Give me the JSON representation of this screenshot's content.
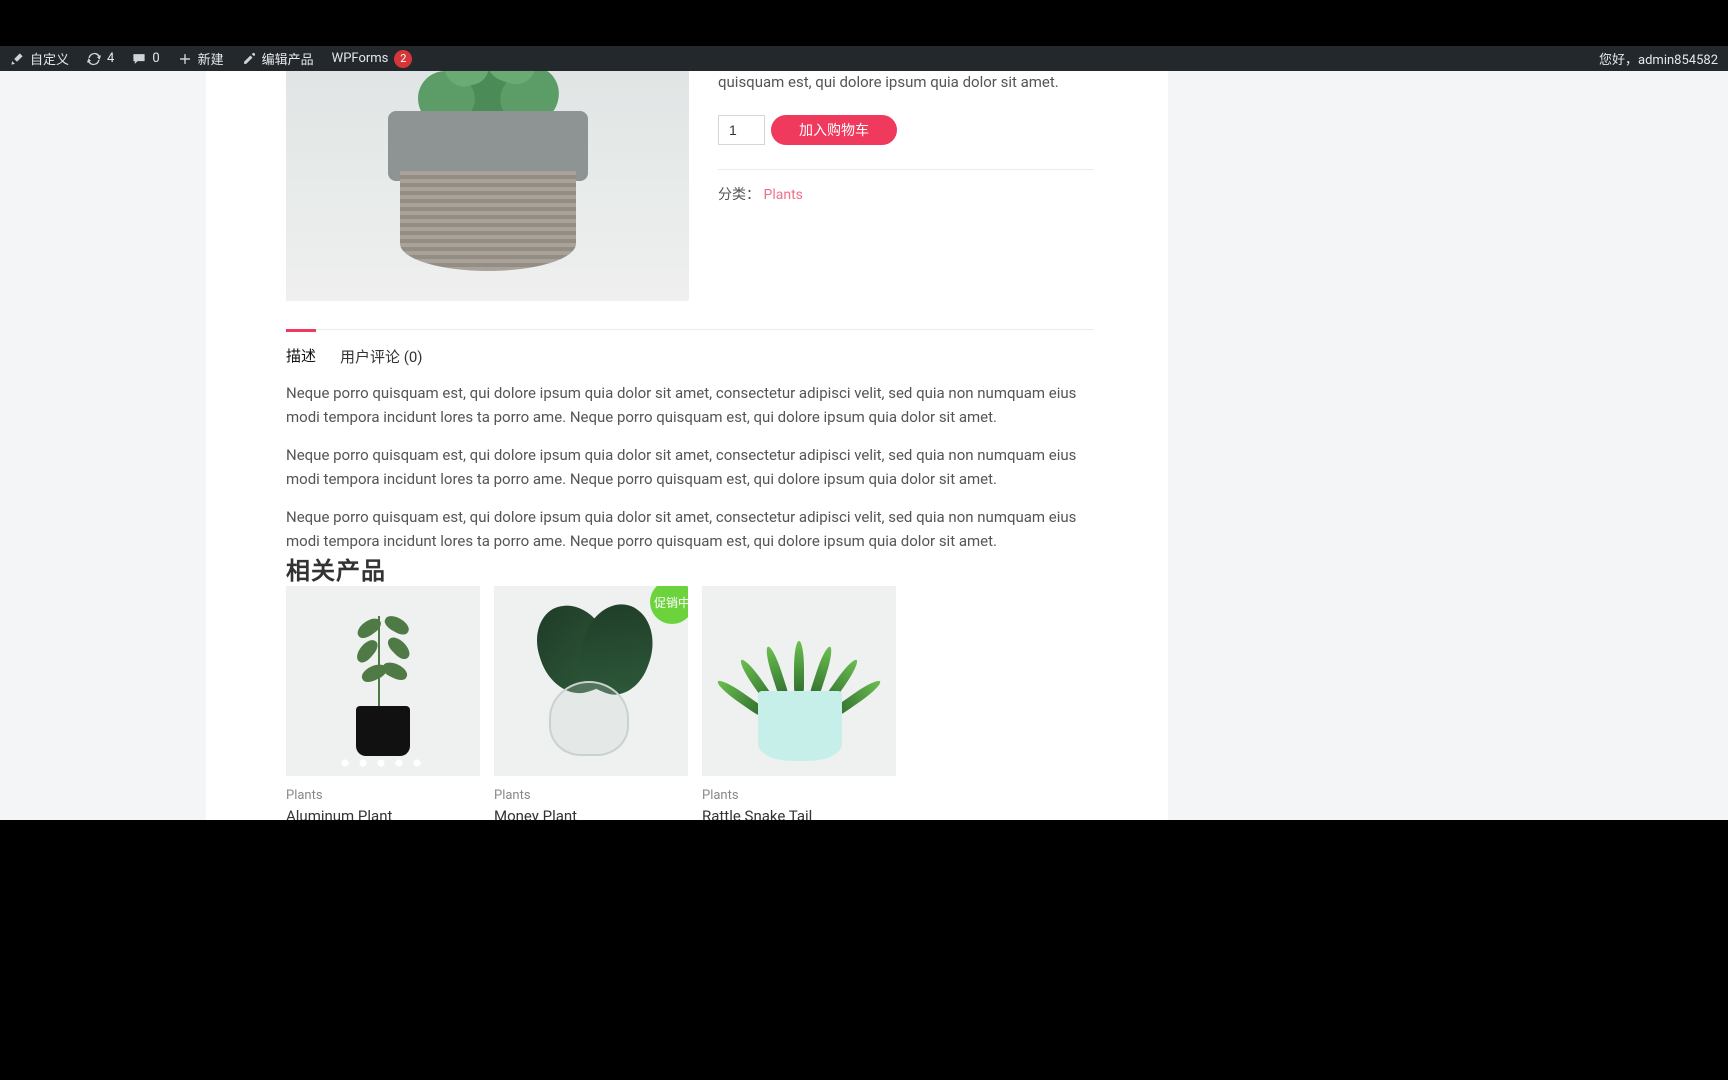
{
  "adminbar": {
    "customize": "自定义",
    "updates_count": "4",
    "comments_count": "0",
    "new": "新建",
    "edit_product": "编辑产品",
    "wpforms": "WPForms",
    "wpforms_badge": "2",
    "greeting": "您好，admin854582"
  },
  "product": {
    "short_desc_tail": "quisquam est, qui dolore ipsum quia dolor sit amet.",
    "qty_value": "1",
    "add_to_cart": "加入购物车",
    "meta_label": "分类：",
    "meta_link": "Plants"
  },
  "tabs": {
    "desc": "描述",
    "reviews": "用户评论 (0)"
  },
  "desc_paras": {
    "p1": "Neque porro quisquam est, qui dolore ipsum quia dolor sit amet, consectetur adipisci velit, sed quia non numquam eius modi tempora incidunt lores ta porro ame. Neque porro quisquam est, qui dolore ipsum quia dolor sit amet.",
    "p2": "Neque porro quisquam est, qui dolore ipsum quia dolor sit amet, consectetur adipisci velit, sed quia non numquam eius modi tempora incidunt lores ta porro ame. Neque porro quisquam est, qui dolore ipsum quia dolor sit amet.",
    "p3": "Neque porro quisquam est, qui dolore ipsum quia dolor sit amet, consectetur adipisci velit, sed quia non numquam eius modi tempora incidunt lores ta porro ame. Neque porro quisquam est, qui dolore ipsum quia dolor sit amet."
  },
  "related": {
    "heading": "相关产品",
    "sale_label": "促销中",
    "items": [
      {
        "cat": "Plants",
        "name": "Aluminum Plant"
      },
      {
        "cat": "Plants",
        "name": "Money Plant"
      },
      {
        "cat": "Plants",
        "name": "Rattle Snake Tail"
      }
    ]
  }
}
